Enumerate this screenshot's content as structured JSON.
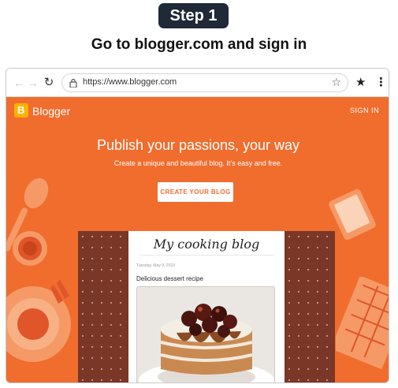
{
  "step": {
    "label": "Step 1"
  },
  "instruction": {
    "text": "Go to blogger.com and sign in"
  },
  "browser": {
    "url": "https://www.blogger.com",
    "icons": [
      "back-arrow-icon",
      "forward-arrow-icon",
      "reload-icon",
      "lock-icon",
      "bookmark-star-icon",
      "menu-dots-icon"
    ]
  },
  "blogger_page": {
    "brand": "Blogger",
    "signin_label": "SIGN IN",
    "headline": "Publish your passions, your way",
    "subheadline": "Create a unique and beautiful blog. It’s easy and free.",
    "cta_label": "CREATE YOUR BLOG",
    "accent_color": "#f06d2e"
  },
  "blog_preview": {
    "title": "My cooking blog",
    "date": "Tuesday, May 9, 2023",
    "post_title": "Delicious dessert recipe"
  }
}
